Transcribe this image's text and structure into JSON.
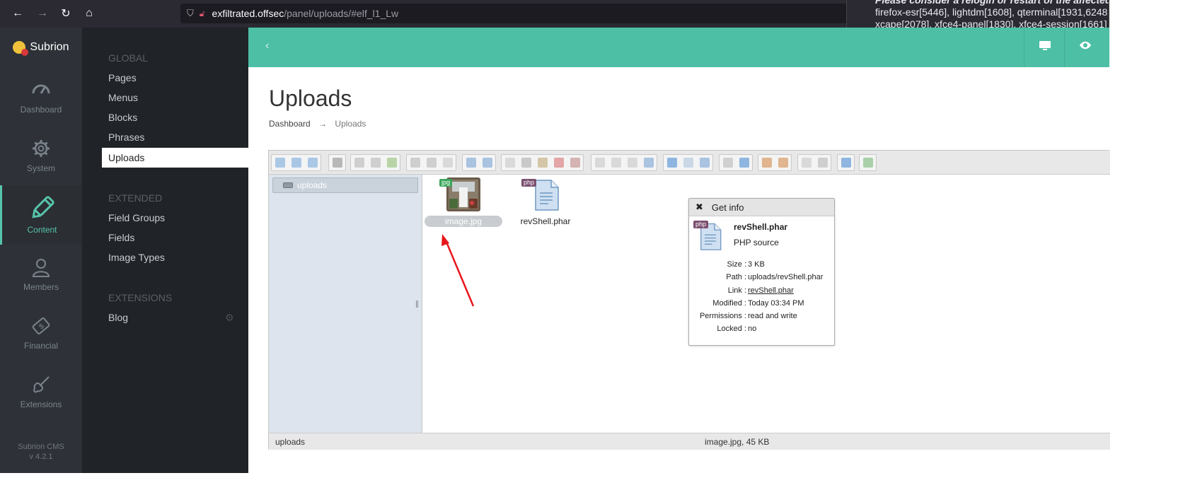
{
  "browser": {
    "url_host": "exfiltrated.offsec",
    "url_path": "/panel/uploads/#elf_l1_Lw",
    "notification_line1": "Please consider a relogin or restart of the affected p",
    "notification_line2": "firefox-esr[5446], lightdm[1608], qterminal[1931,6248",
    "notification_line3": "xcape[2078], xfce4-panel[1830], xfce4-session[1661]"
  },
  "sidebar": {
    "brand": "Subrion",
    "nav": [
      {
        "label": "Dashboard",
        "icon": "dashboard-gauge-icon"
      },
      {
        "label": "System",
        "icon": "gear-icon"
      },
      {
        "label": "Content",
        "icon": "pencil-icon"
      },
      {
        "label": "Members",
        "icon": "user-icon"
      },
      {
        "label": "Financial",
        "icon": "money-icon"
      },
      {
        "label": "Extensions",
        "icon": "guitar-icon"
      }
    ],
    "version_line1": "Subrion CMS",
    "version_line2": "v 4.2.1"
  },
  "submenu": {
    "global_title": "GLOBAL",
    "global_items": [
      "Pages",
      "Menus",
      "Blocks",
      "Phrases",
      "Uploads"
    ],
    "extended_title": "EXTENDED",
    "extended_items": [
      "Field Groups",
      "Fields",
      "Image Types"
    ],
    "extensions_title": "EXTENSIONS",
    "extensions_items": [
      "Blog"
    ]
  },
  "page": {
    "title": "Uploads",
    "breadcrumb_home": "Dashboard",
    "breadcrumb_arrow": "→",
    "breadcrumb_current": "Uploads"
  },
  "filemanager": {
    "tree_root": "uploads",
    "files": [
      {
        "name": "image.jpg",
        "badge": "jpg",
        "selected": true
      },
      {
        "name": "revShell.phar",
        "badge": "php",
        "selected": false
      }
    ],
    "status_left": "uploads",
    "status_middle": "image.jpg, 45 KB"
  },
  "dialog": {
    "title": "Get info",
    "close": "✖",
    "file_name": "revShell.phar",
    "file_kind": "PHP source",
    "icon_badge": "php",
    "rows": [
      {
        "key": "Size :",
        "value": "3 KB"
      },
      {
        "key": "Path :",
        "value": "uploads/revShell.phar"
      },
      {
        "key": "Link :",
        "value": "revShell.phar"
      },
      {
        "key": "Modified :",
        "value": "Today 03:34 PM"
      },
      {
        "key": "Permissions :",
        "value": "read and write"
      },
      {
        "key": "Locked :",
        "value": "no"
      }
    ]
  },
  "colors": {
    "accent": "#4dbfa5",
    "sidebar_dark": "#2e3238",
    "submenu_dark": "#202327",
    "annotation_arrow": "#e8151b"
  }
}
